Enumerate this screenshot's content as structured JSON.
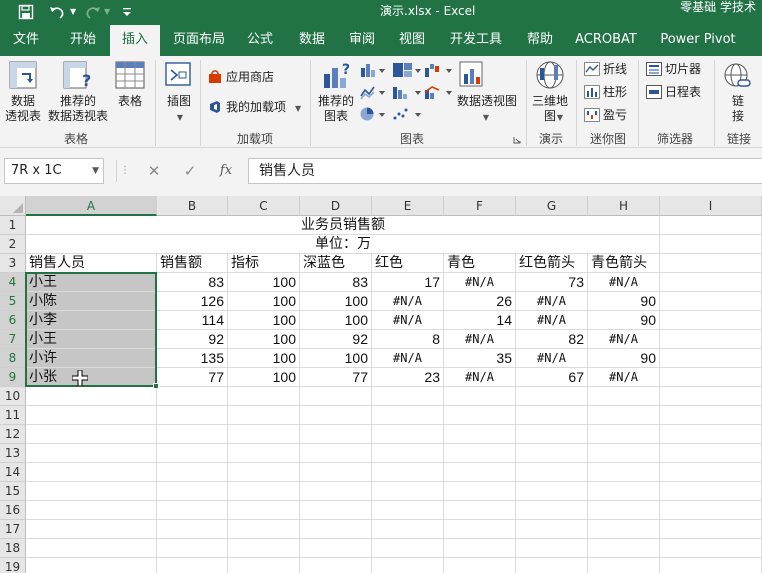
{
  "title_bar": {
    "doc_title": "演示.xlsx  -  Excel",
    "brand": "零基础 学技术"
  },
  "ribbon_tabs": [
    "文件",
    "开始",
    "插入",
    "页面布局",
    "公式",
    "数据",
    "审阅",
    "视图",
    "开发工具",
    "帮助",
    "ACROBAT",
    "Power Pivot"
  ],
  "active_tab": "插入",
  "ribbon": {
    "tables_group": {
      "pivot_table": [
        "数据",
        "透视表"
      ],
      "recommended_pivot": [
        "推荐的",
        "数据透视表"
      ],
      "table": "表格",
      "label": "表格"
    },
    "illustrations": {
      "label": "插图"
    },
    "addins_group": {
      "store": "应用商店",
      "my_addins": "我的加载项",
      "label": "加载项"
    },
    "charts_group": {
      "recommended_charts": [
        "推荐的",
        "图表"
      ],
      "pivot_chart": "数据透视图",
      "label": "图表"
    },
    "tours_group": {
      "map_3d": [
        "三维地",
        "图"
      ],
      "label": "演示"
    },
    "sparklines_group": {
      "line": "折线",
      "column": "柱形",
      "win_loss": "盈亏",
      "label": "迷你图"
    },
    "filters_group": {
      "slicer": "切片器",
      "timeline": "日程表",
      "label": "筛选器"
    },
    "links_group": {
      "link": [
        "链",
        "接"
      ],
      "label": "链接"
    }
  },
  "formula_bar": {
    "name_box": "7R x 1C",
    "cancel": "✕",
    "enter": "✓",
    "fx": "fx",
    "content": "销售人员"
  },
  "sheet": {
    "columns": [
      "A",
      "B",
      "C",
      "D",
      "E",
      "F",
      "G",
      "H",
      "I"
    ],
    "rows": [
      "1",
      "2",
      "3",
      "4",
      "5",
      "6",
      "7",
      "8",
      "9",
      "10",
      "11",
      "12",
      "13",
      "14",
      "15",
      "16",
      "17",
      "18",
      "19"
    ],
    "title": "业务员销售额",
    "unit": "单位：万",
    "headers": [
      "销售人员",
      "销售额",
      "指标",
      "深蓝色",
      "红色",
      "青色",
      "红色箭头",
      "青色箭头"
    ],
    "data": [
      [
        "小王",
        "83",
        "100",
        "83",
        "17",
        "#N/A",
        "73",
        "#N/A"
      ],
      [
        "小陈",
        "126",
        "100",
        "100",
        "#N/A",
        "26",
        "#N/A",
        "90"
      ],
      [
        "小李",
        "114",
        "100",
        "100",
        "#N/A",
        "14",
        "#N/A",
        "90"
      ],
      [
        "小王",
        "92",
        "100",
        "92",
        "8",
        "#N/A",
        "82",
        "#N/A"
      ],
      [
        "小许",
        "135",
        "100",
        "100",
        "#N/A",
        "35",
        "#N/A",
        "90"
      ],
      [
        "小张",
        "77",
        "100",
        "77",
        "23",
        "#N/A",
        "67",
        "#N/A"
      ]
    ]
  },
  "colors": {
    "excel_green": "#217346",
    "ribbon_bg": "#f3f3f3",
    "selection_fill": "#c6c6c6"
  }
}
